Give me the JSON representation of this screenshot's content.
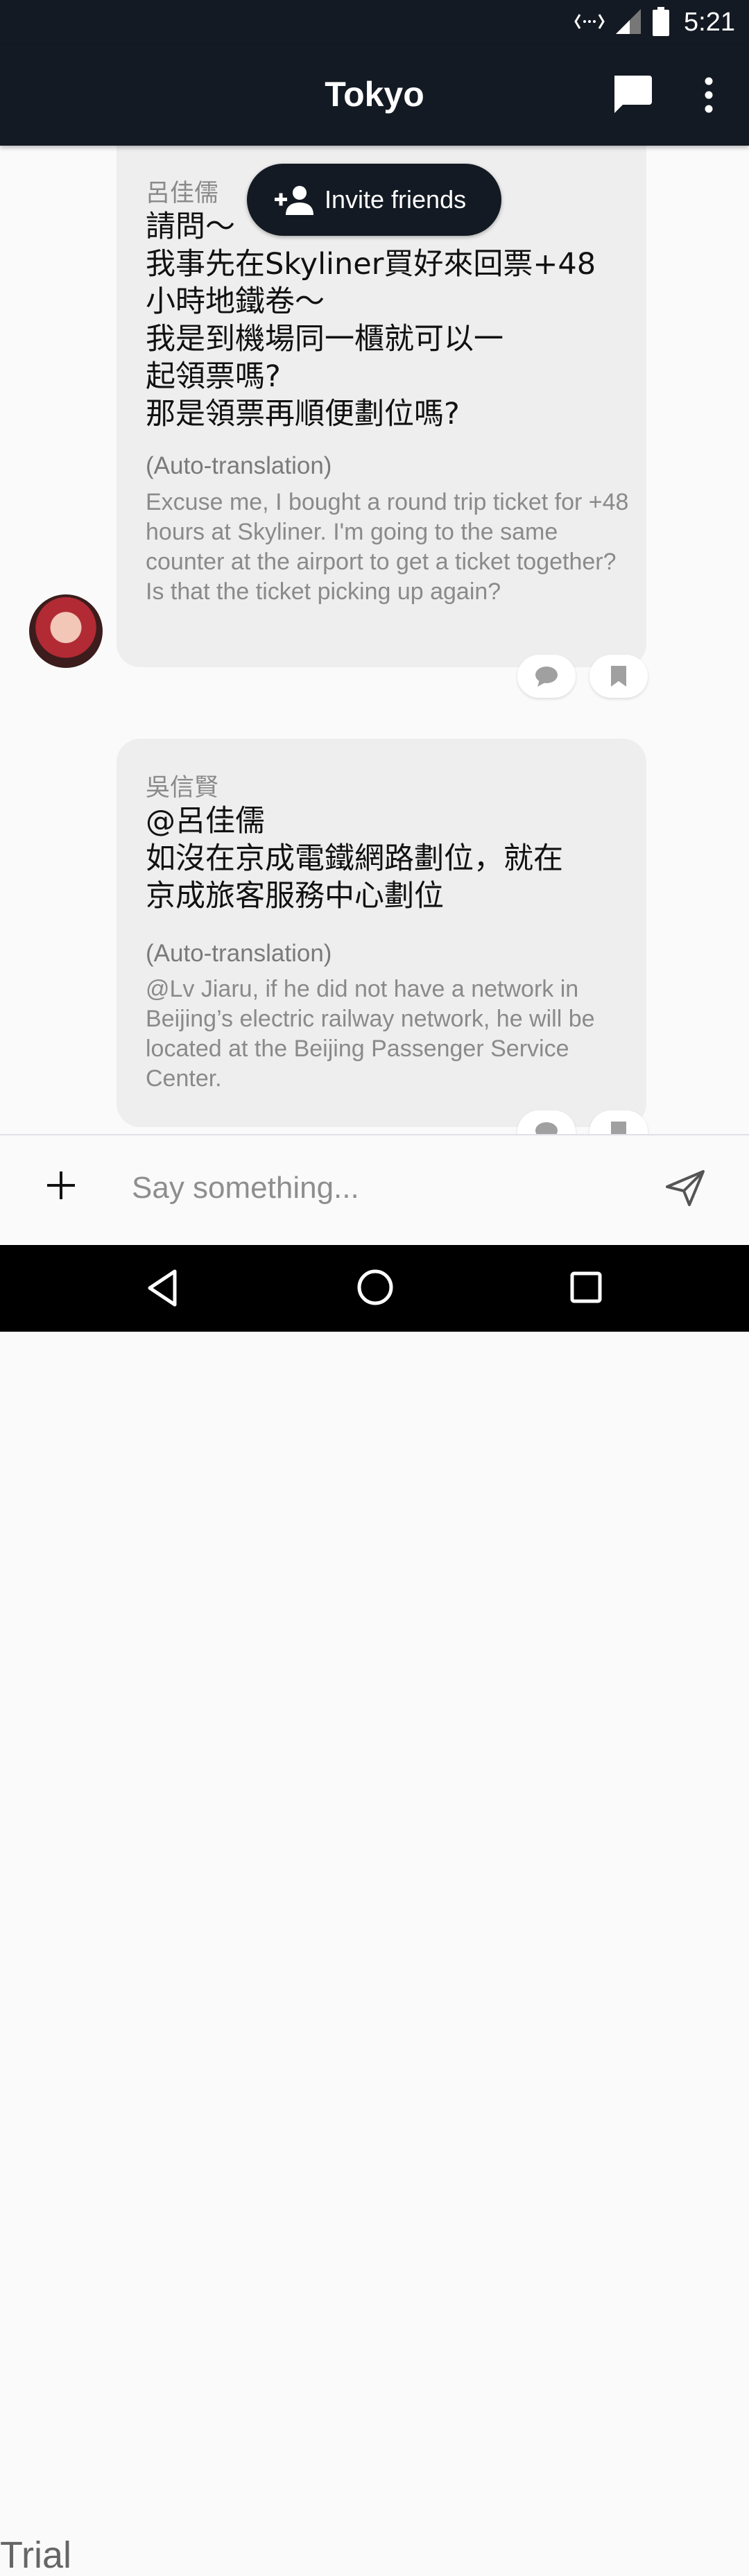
{
  "status_bar": {
    "time": "5:21"
  },
  "app_bar": {
    "title": "Tokyo"
  },
  "invite": {
    "label": "Invite friends"
  },
  "messages": [
    {
      "sender": "呂佳儒",
      "text": "請問～\n我事先在Skyliner買好來回票+48\n小時地鐵卷～\n我是到機場同一櫃就可以一\n起領票嗎?\n那是領票再順便劃位嗎?",
      "auto_label": "(Auto-translation)",
      "translation": "Excuse me, I bought a round trip ticket for +48 hours at Skyliner. I'm going to the same counter at the airport to get a ticket together? Is that the ticket picking up again?"
    },
    {
      "sender": "吳信賢",
      "text": "@呂佳儒\n如沒在京成電鐵網路劃位，就在\n京成旅客服務中心劃位",
      "auto_label": "(Auto-translation)",
      "translation": "@Lv Jiaru, if he did not have a network in Beijing’s electric railway network, he will be located at the Beijing Passenger Service Center."
    }
  ],
  "input_bar": {
    "placeholder": "Say something..."
  },
  "watermark": "Trial",
  "colors": {
    "bar": "#141a23",
    "bubble": "#eeeeee",
    "background": "#fafafa"
  },
  "icons": [
    "data-icon",
    "signal-icon",
    "battery-icon",
    "chat-icon",
    "more-vert-icon",
    "add-person-icon",
    "comment-icon",
    "bookmark-icon",
    "plus-icon",
    "send-icon",
    "back-icon",
    "home-icon",
    "recents-icon"
  ]
}
